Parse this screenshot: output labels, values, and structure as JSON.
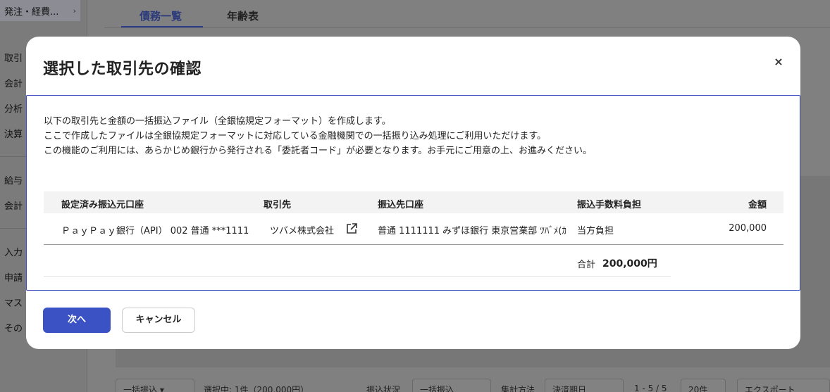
{
  "sidebar": {
    "top_item": "発注・経費...",
    "items": [
      "取引",
      "会計",
      "分析",
      "決算",
      "給与",
      "会計",
      "入力",
      "申請",
      "マス",
      "その"
    ]
  },
  "tabs": [
    {
      "label": "債務一覧",
      "active": true
    },
    {
      "label": "年齢表",
      "active": false
    }
  ],
  "bottom_toolbar": {
    "bulk_transfer": "一括振込",
    "selected": "選択中: 1件（200,000円）",
    "transfer_status_label": "振込状況",
    "transfer_status_value": "一括振込",
    "aggregate_label": "集計方法",
    "aggregate_value": "決済期日",
    "pagination": "1 - 5 / 5",
    "per_page": "20件",
    "export": "エクスポート"
  },
  "modal": {
    "title": "選択した取引先の確認",
    "close_icon": "×",
    "description": [
      "以下の取引先と金額の一括振込ファイル（全銀協規定フォーマット）を作成します。",
      "ここで作成したファイルは全銀協規定フォーマットに対応している金融機関での一括振り込み処理にご利用いただけます。",
      "この機能のご利用には、あらかじめ銀行から発行される「委託者コード」が必要となります。お手元にご用意の上、お進みください。"
    ],
    "table": {
      "headers": [
        "設定済み振込元口座",
        "取引先",
        "振込先口座",
        "振込手数料負担",
        "金額"
      ],
      "rows": [
        {
          "source_account": "ＰａｙＰａｙ銀行（API） 002 普通 ***1111",
          "partner": "ツバメ株式会社",
          "dest_account": "普通 1111111 みずほ銀行 東京営業部 ﾂﾊﾞﾒ(ｶ",
          "fee": "当方負担",
          "amount": "200,000"
        }
      ],
      "total_label": "合計",
      "total_value": "200,000円"
    },
    "next_button": "次へ",
    "cancel_button": "キャンセル"
  },
  "colors": {
    "primary": "#3a52c4",
    "overlay": "#7f7f80",
    "table_header_bg": "#f4f3f4"
  }
}
